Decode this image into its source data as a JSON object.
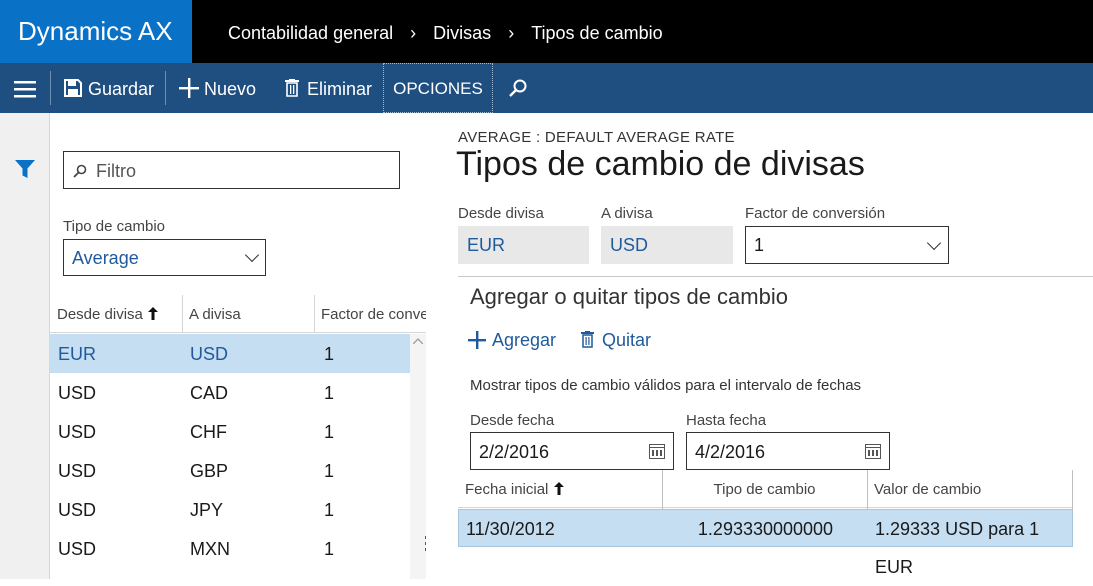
{
  "app": {
    "title": "Dynamics AX"
  },
  "breadcrumb": [
    "Contabilidad general",
    "Divisas",
    "Tipos de cambio"
  ],
  "toolbar": {
    "save_label": "Guardar",
    "new_label": "Nuevo",
    "delete_label": "Eliminar",
    "options_label": "OPCIONES"
  },
  "list": {
    "filter_placeholder": "Filtro",
    "exchange_type_label": "Tipo de cambio",
    "exchange_type_value": "Average",
    "columns": [
      "Desde divisa",
      "A divisa",
      "Factor de conve"
    ],
    "rows": [
      {
        "from": "EUR",
        "to": "USD",
        "factor": "1",
        "selected": true
      },
      {
        "from": "USD",
        "to": "CAD",
        "factor": "1"
      },
      {
        "from": "USD",
        "to": "CHF",
        "factor": "1"
      },
      {
        "from": "USD",
        "to": "GBP",
        "factor": "1"
      },
      {
        "from": "USD",
        "to": "JPY",
        "factor": "1"
      },
      {
        "from": "USD",
        "to": "MXN",
        "factor": "1"
      }
    ]
  },
  "detail": {
    "caption": "AVERAGE : DEFAULT AVERAGE RATE",
    "title": "Tipos de cambio de divisas",
    "from_label": "Desde divisa",
    "from_value": "EUR",
    "to_label": "A divisa",
    "to_value": "USD",
    "factor_label": "Factor de conversión",
    "factor_value": "1",
    "section_title": "Agregar o quitar tipos de cambio",
    "add_label": "Agregar",
    "remove_label": "Quitar",
    "range_note": "Mostrar tipos de cambio válidos para el intervalo de fechas",
    "from_date_label": "Desde fecha",
    "from_date_value": "2/2/2016",
    "to_date_label": "Hasta fecha",
    "to_date_value": "4/2/2016",
    "grid_columns": [
      "Fecha inicial",
      "Tipo de cambio",
      "Valor de cambio"
    ],
    "grid_rows": [
      {
        "start": "11/30/2012",
        "rate": "1.293330000000",
        "value": "1.29333 USD para 1 EUR"
      }
    ]
  },
  "colors": {
    "brand": "#0a72c6",
    "actionbar": "#1f4e80",
    "selection": "#c6def1",
    "link": "#1f5a9c"
  }
}
